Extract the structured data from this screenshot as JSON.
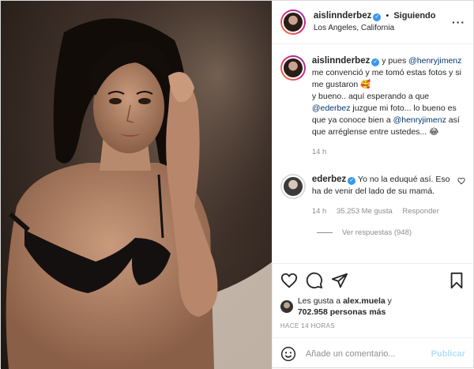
{
  "post": {
    "author": "aislinnderbez",
    "dot": "•",
    "follow_state": "Siguiendo",
    "location": "Los Angeles, California",
    "more_icon": "more-dots-icon"
  },
  "caption": {
    "author": "aislinnderbez",
    "t1": "y pues ",
    "m1": "@henryjimenz",
    "t2": " me convenció y me tomó estas fotos y si me gustaron 🥰",
    "t3": "y bueno.. aquí esperando a que ",
    "m2": "@ederbez",
    "t4": " juzgue mi foto... lo bueno es que ya conoce bien a ",
    "m3": "@henryjimenz",
    "t5": " así que arréglense entre ustedes... 😂",
    "time": "14 h"
  },
  "reply": {
    "author": "ederbez",
    "text": "Yo no la eduqué así. Eso ha de venir del lado de su mamá.",
    "time": "14 h",
    "likes": "35.253 Me gusta",
    "reply_label": "Responder",
    "view_replies": "Ver respuestas (948)"
  },
  "actions": {
    "liked_by_prefix": "Les gusta a ",
    "liked_by_user": "alex.muela",
    "liked_by_mid": " y ",
    "liked_by_others": "702.958 personas más",
    "timestamp": "HACE 14 HORAS"
  },
  "comment_box": {
    "placeholder": "Añade un comentario...",
    "publish_label": "Publicar"
  },
  "colors": {
    "accent": "#3897f0",
    "link": "#00376b",
    "muted": "#8e8e8e",
    "publish_disabled": "#b2dffc"
  }
}
